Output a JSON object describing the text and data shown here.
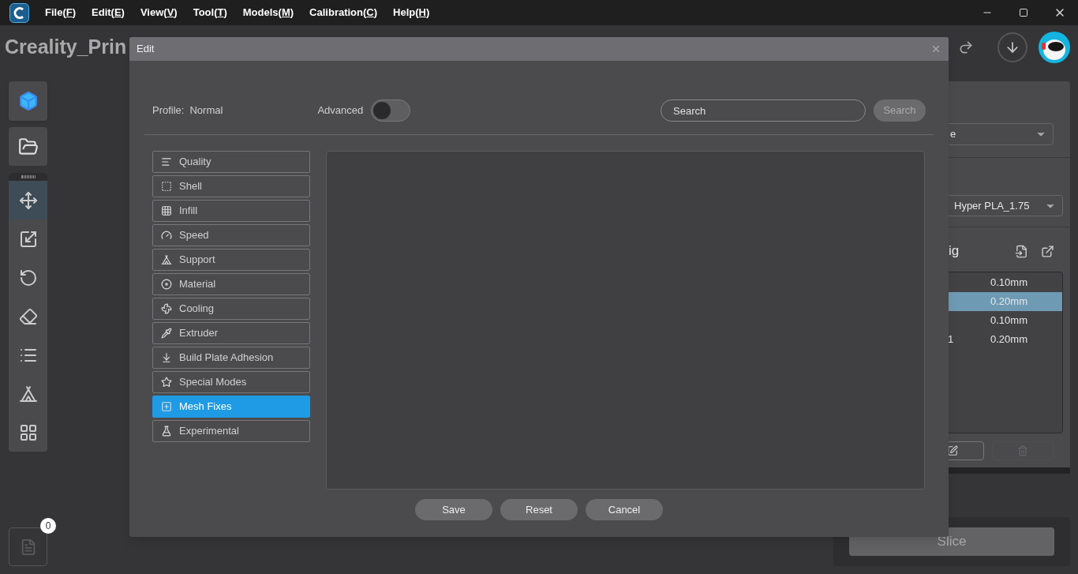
{
  "menu": [
    {
      "prefix": "File(",
      "key": "F",
      "suffix": ")"
    },
    {
      "prefix": "Edit(",
      "key": "E",
      "suffix": ")"
    },
    {
      "prefix": "View(",
      "key": "V",
      "suffix": ")"
    },
    {
      "prefix": "Tool(",
      "key": "T",
      "suffix": ")"
    },
    {
      "prefix": "Models(",
      "key": "M",
      "suffix": ")"
    },
    {
      "prefix": "Calibration(",
      "key": "C",
      "suffix": ")"
    },
    {
      "prefix": "Help(",
      "key": "H",
      "suffix": ")"
    }
  ],
  "app_title": "Creality_Prin",
  "left_tools": [
    {
      "kind": "move",
      "selected": true
    },
    {
      "kind": "scale",
      "selected": false
    },
    {
      "kind": "rotate",
      "selected": false
    },
    {
      "kind": "lay-flat",
      "selected": false
    },
    {
      "kind": "list",
      "selected": false
    },
    {
      "kind": "support",
      "selected": false
    },
    {
      "kind": "arrange",
      "selected": false
    }
  ],
  "file_count": "0",
  "right_panel": {
    "printer_select": "e",
    "filament_select": "Hyper PLA_1.75",
    "config_title": "ig",
    "profiles": [
      {
        "height": "0.10mm",
        "selected": false
      },
      {
        "height": "0.20mm",
        "selected": true
      },
      {
        "height": "0.10mm",
        "selected": false
      },
      {
        "name": "1",
        "height": "0.20mm",
        "selected": false
      }
    ],
    "slice_button": "Slice"
  },
  "dialog": {
    "title": "Edit",
    "profile_label": "Profile:",
    "profile_value": "Normal",
    "advanced_label": "Advanced",
    "advanced_on": false,
    "search_placeholder": "Search",
    "search_button": "Search",
    "categories": [
      {
        "label": "Quality",
        "kind": "quality",
        "selected": false
      },
      {
        "label": "Shell",
        "kind": "shell",
        "selected": false
      },
      {
        "label": "Infill",
        "kind": "infill",
        "selected": false
      },
      {
        "label": "Speed",
        "kind": "speed",
        "selected": false
      },
      {
        "label": "Support",
        "kind": "support",
        "selected": false
      },
      {
        "label": "Material",
        "kind": "material",
        "selected": false
      },
      {
        "label": "Cooling",
        "kind": "cooling",
        "selected": false
      },
      {
        "label": "Extruder",
        "kind": "extruder",
        "selected": false
      },
      {
        "label": "Build Plate Adhesion",
        "kind": "adhesion",
        "selected": false
      },
      {
        "label": "Special Modes",
        "kind": "special",
        "selected": false
      },
      {
        "label": "Mesh Fixes",
        "kind": "mesh",
        "selected": true
      },
      {
        "label": "Experimental",
        "kind": "experimental",
        "selected": false
      }
    ],
    "buttons": [
      "Save",
      "Reset",
      "Cancel"
    ]
  }
}
